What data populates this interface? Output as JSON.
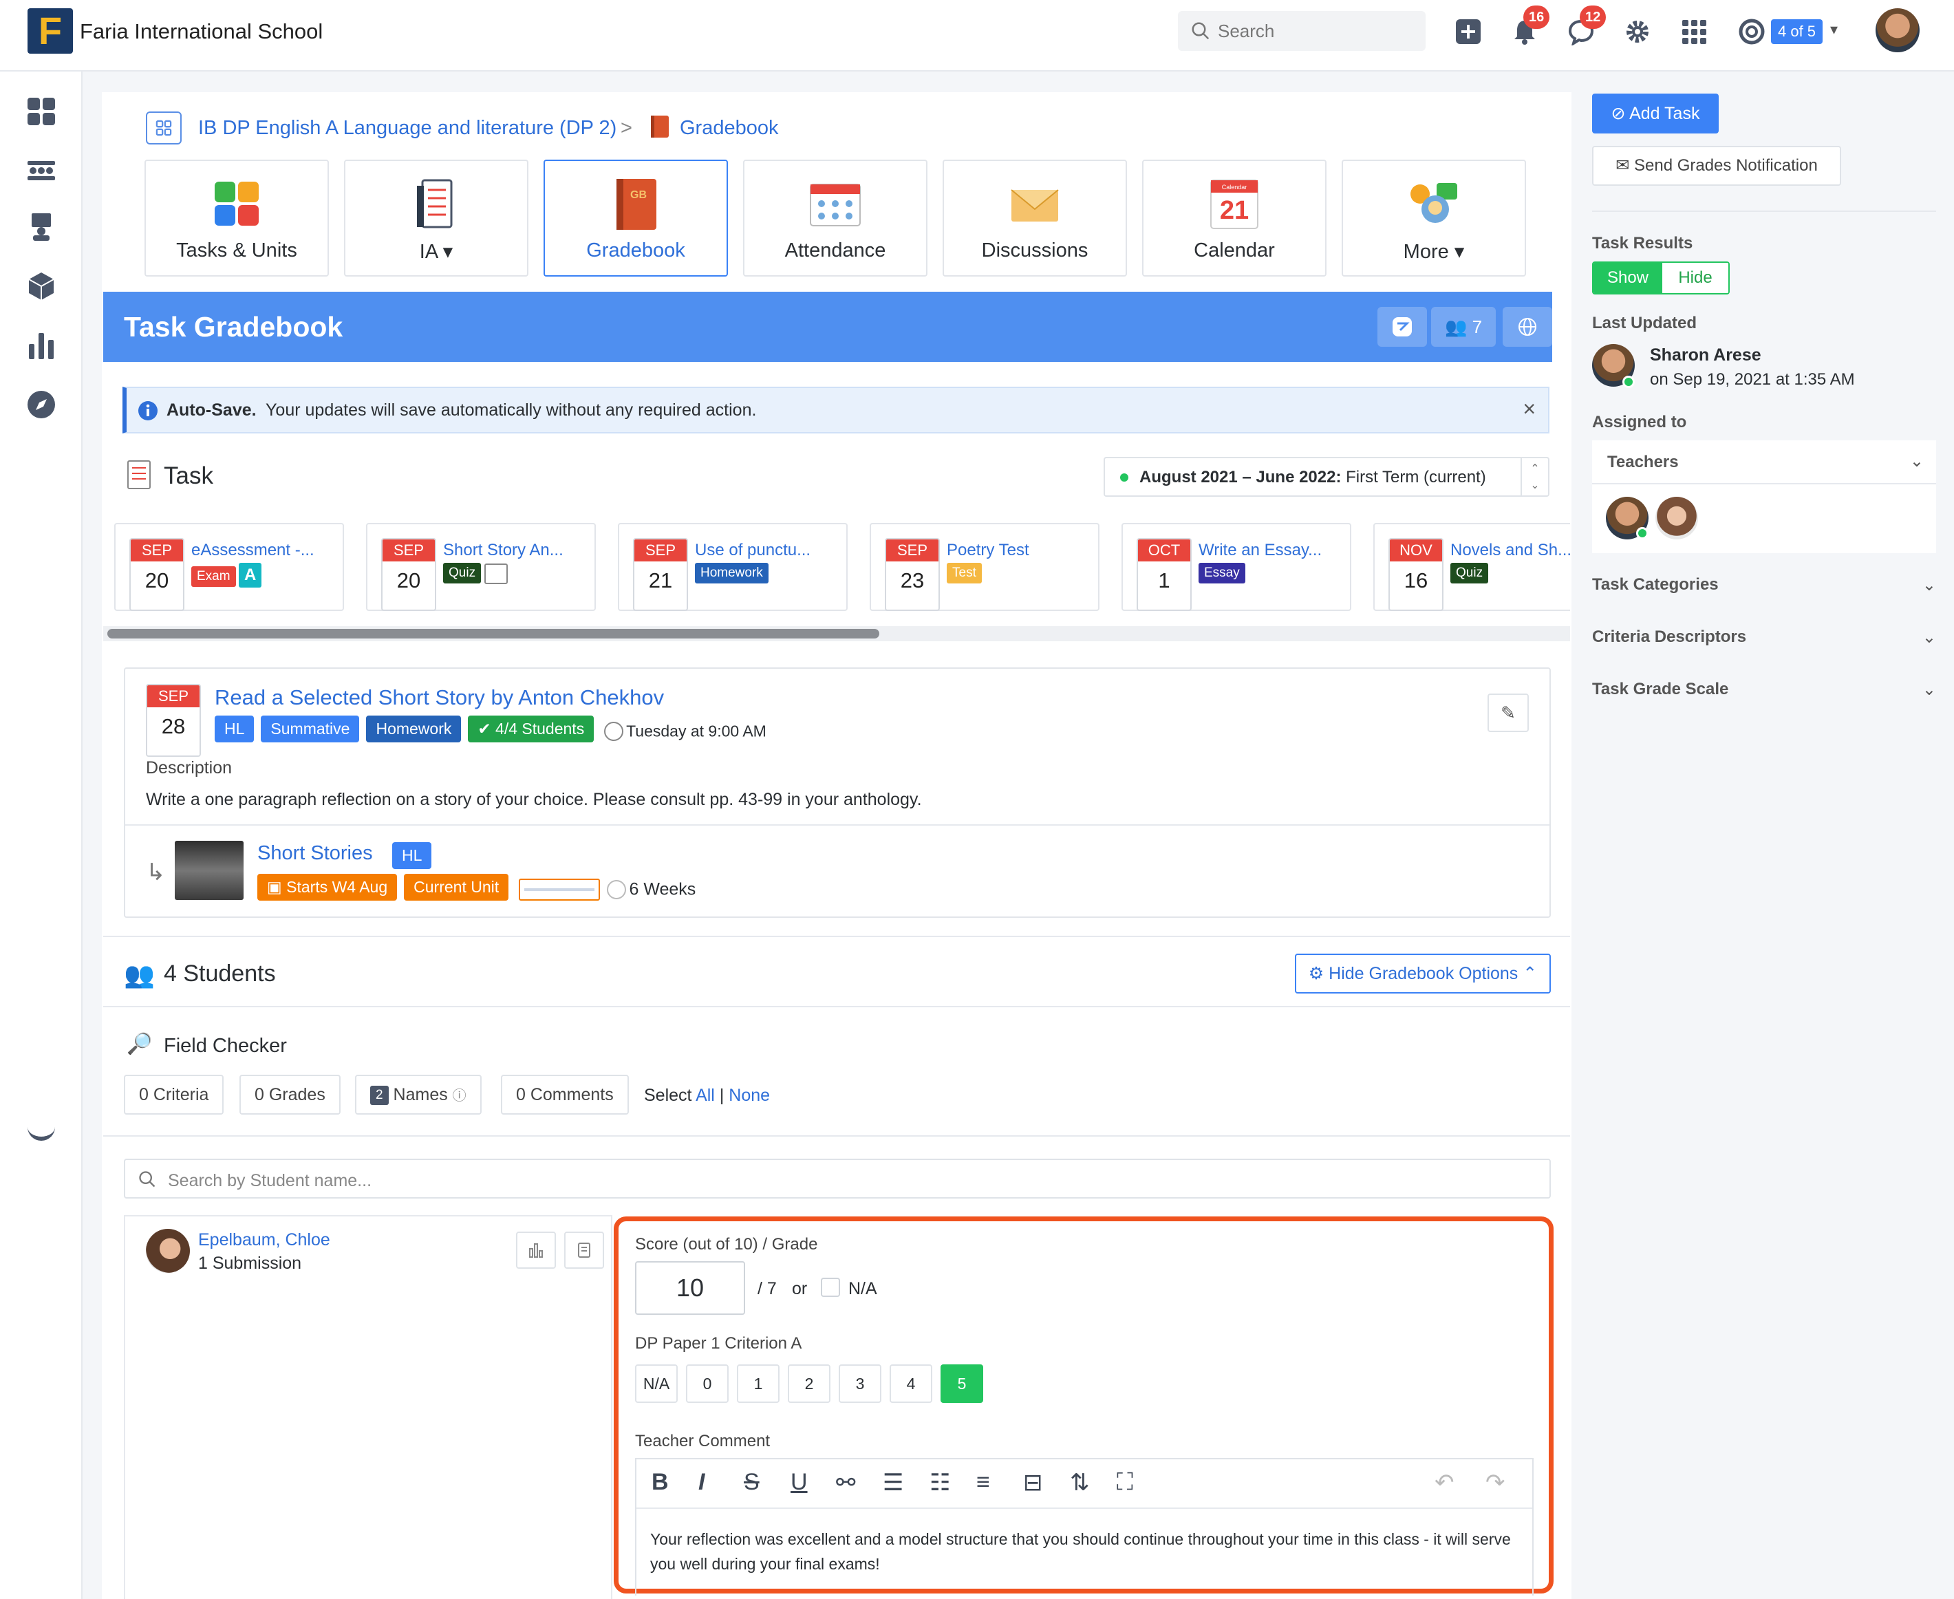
{
  "topbar": {
    "school_name": "Faria International School",
    "search_placeholder": "Search",
    "notifications_count": "16",
    "messages_count": "12",
    "account_counter": "4 of 5"
  },
  "breadcrumb": {
    "class": "IB DP English A Language and literature (DP 2)",
    "separator": ">",
    "page": "Gradebook"
  },
  "nav_tiles": [
    {
      "label": "Tasks & Units"
    },
    {
      "label": "IA ▾"
    },
    {
      "label": "Gradebook"
    },
    {
      "label": "Attendance"
    },
    {
      "label": "Discussions"
    },
    {
      "label": "Calendar"
    },
    {
      "label": "More ▾"
    }
  ],
  "calendar_icon": {
    "month": "Calendar",
    "day": "21"
  },
  "gradebook_icon_text": "GB",
  "header": {
    "title": "Task Gradebook",
    "students_count": "7"
  },
  "autosave": {
    "bold": "Auto-Save.",
    "text": "Your updates will save automatically without any required action."
  },
  "task_section": {
    "label": "Task",
    "term": "August 2021 – June 2022:",
    "term_suffix": "First Term (current)"
  },
  "tasks": [
    {
      "month": "SEP",
      "day": "20",
      "title": "eAssessment -...",
      "tag": "Exam",
      "tag2": "A"
    },
    {
      "month": "SEP",
      "day": "20",
      "title": "Short Story An...",
      "tag": "Quiz"
    },
    {
      "month": "SEP",
      "day": "21",
      "title": "Use of punctu...",
      "tag": "Homework"
    },
    {
      "month": "SEP",
      "day": "23",
      "title": "Poetry Test",
      "tag": "Test"
    },
    {
      "month": "OCT",
      "day": "1",
      "title": "Write an Essay...",
      "tag": "Essay"
    },
    {
      "month": "NOV",
      "day": "16",
      "title": "Novels and Sh...",
      "tag": "Quiz"
    }
  ],
  "selected_task": {
    "month": "SEP",
    "day": "28",
    "title": "Read a Selected Short Story by Anton Chekhov",
    "tags": [
      "HL",
      "Summative",
      "Homework",
      "4/4 Students"
    ],
    "due": "Tuesday at 9:00 AM",
    "description_label": "Description",
    "description": "Write a one paragraph reflection on a story of your choice. Please consult pp. 43-99 in your anthology.",
    "unit_title": "Short Stories",
    "unit_level": "HL",
    "unit_start": "Starts W4 Aug",
    "unit_status": "Current Unit",
    "unit_duration": "6 Weeks"
  },
  "students": {
    "heading": "4 Students",
    "options_button": "Hide Gradebook Options",
    "field_checker": "Field Checker",
    "criteria_btn": "0 Criteria",
    "grades_btn": "0 Grades",
    "names_count": "2",
    "names_btn": "Names",
    "comments_btn": "0 Comments",
    "select_label": "Select",
    "select_all": "All",
    "select_sep": "|",
    "select_none": "None",
    "search_placeholder": "Search by Student name..."
  },
  "student": {
    "name": "Epelbaum, Chloe",
    "submissions": "1 Submission"
  },
  "grading": {
    "score_label": "Score (out of 10) / Grade",
    "score_value": "10",
    "grade_value": "/ 7",
    "or": "or",
    "na": "N/A",
    "criterion_label": "DP Paper 1 Criterion A",
    "levels": [
      "N/A",
      "0",
      "1",
      "2",
      "3",
      "4",
      "5"
    ],
    "selected_level": "5",
    "comment_label": "Teacher Comment",
    "comment": "Your reflection was excellent and a model structure that you should continue throughout your time in this class - it will serve you well during your final exams!"
  },
  "right_panel": {
    "add_task": "Add Task",
    "send_notification": "Send Grades Notification",
    "task_results": "Task Results",
    "show": "Show",
    "hide": "Hide",
    "last_updated": "Last Updated",
    "updater_name": "Sharon Arese",
    "updated_at": "on Sep 19, 2021 at 1:35 AM",
    "assigned_to": "Assigned to",
    "teachers": "Teachers",
    "task_categories": "Task Categories",
    "criteria_descriptors": "Criteria Descriptors",
    "task_grade_scale": "Task Grade Scale"
  },
  "colors": {
    "accent": "#3b82f6",
    "header_blue": "#4f8ff0",
    "highlight_orange": "#f0531f",
    "success_green": "#22c55e",
    "danger_red": "#e8453c"
  }
}
